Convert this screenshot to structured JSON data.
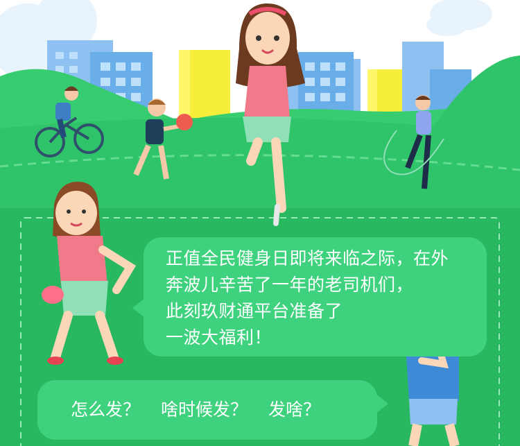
{
  "intro": {
    "lines": [
      "正值全民健身日即将来临之际，在外",
      "奔波儿辛苦了一年的老司机们，",
      "此刻玖财通平台准备了",
      "一波大福利！"
    ]
  },
  "questions": [
    "怎么发？",
    "啥时候发？",
    "发啥？"
  ],
  "colors": {
    "sky": "#ffffff",
    "grass": "#2fc36a",
    "panel": "#28b860",
    "bubble": "#3fd27e",
    "dashed_border": "#9be8b7"
  },
  "icons": [
    "cyclist-figure",
    "tennis-player-figure",
    "running-woman-figure",
    "jump-rope-figure",
    "dumbbell-woman-figure",
    "thinking-man-figure",
    "city-buildings"
  ]
}
